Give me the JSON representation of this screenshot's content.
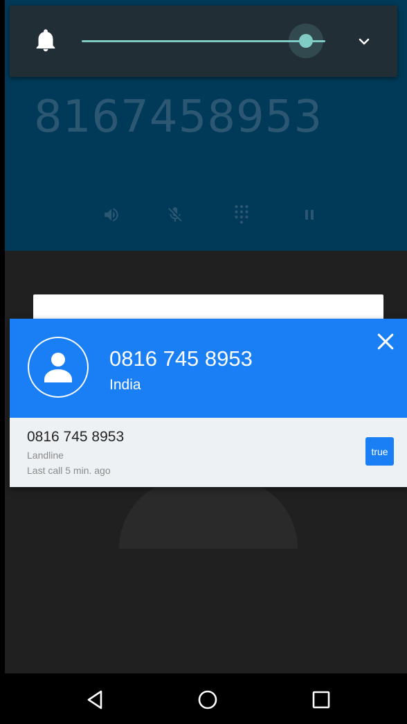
{
  "call_screen": {
    "dialed_number": "8167458953",
    "controls": [
      "speaker-icon",
      "mute-mic-icon",
      "dialpad-icon",
      "pause-icon"
    ]
  },
  "volume_panel": {
    "icon": "bell-icon",
    "level": 0.92,
    "expand_icon": "chevron-down-icon",
    "accent_color": "#80cbc4"
  },
  "caller_overlay": {
    "number": "0816 745 8953",
    "location": "India",
    "detail_number": "0816 745 8953",
    "line_type": "Landline",
    "last_call": "Last call 5 min. ago",
    "badge": "true",
    "accent_color": "#1a7ff5"
  },
  "navigation": {
    "items": [
      "back-icon",
      "home-icon",
      "recents-icon"
    ]
  }
}
